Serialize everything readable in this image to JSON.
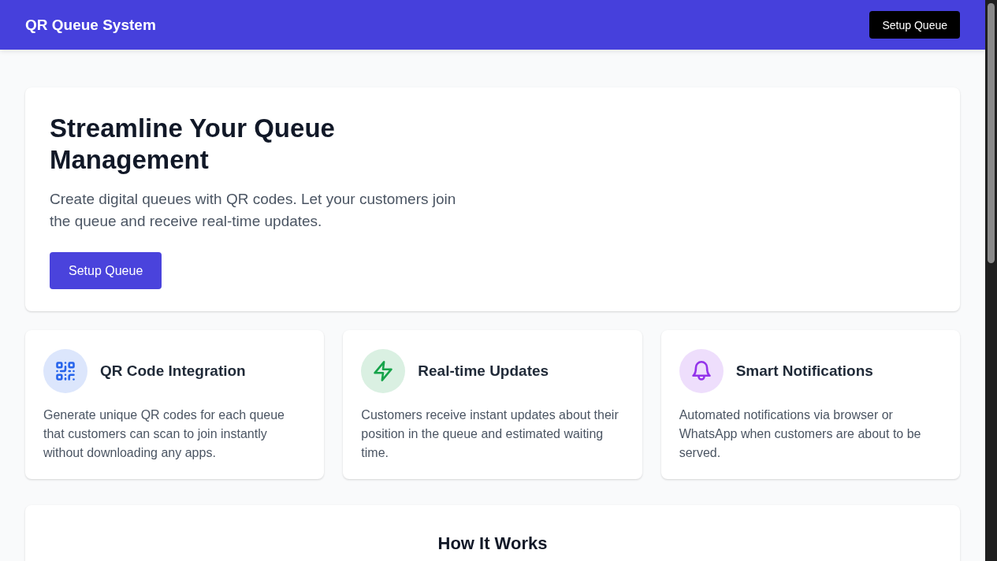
{
  "header": {
    "title": "QR Queue System",
    "button": "Setup Queue"
  },
  "hero": {
    "heading": "Streamline Your Queue Management",
    "text": "Create digital queues with QR codes. Let your customers join the queue and receive real-time updates.",
    "button": "Setup Queue"
  },
  "features": [
    {
      "kind": "qr",
      "color": "#2563eb",
      "title": "QR Code Integration",
      "description": "Generate unique QR codes for each queue that customers can scan to join instantly without downloading any apps."
    },
    {
      "kind": "bolt",
      "color": "#16a34a",
      "title": "Real-time Updates",
      "description": "Customers receive instant updates about their position in the queue and estimated waiting time."
    },
    {
      "kind": "bell",
      "color": "#9333ea",
      "title": "Smart Notifications",
      "description": "Automated notifications via browser or WhatsApp when customers are about to be served."
    }
  ],
  "how_it_works": {
    "title": "How It Works"
  }
}
